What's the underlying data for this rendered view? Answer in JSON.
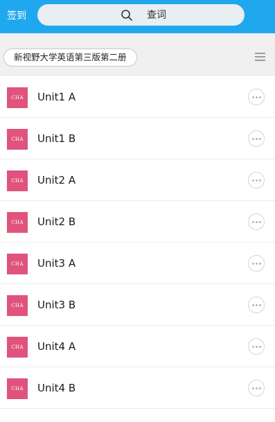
{
  "header": {
    "checkin_label": "签到",
    "search_label": "查词",
    "background_color": "#1fa8ee"
  },
  "book": {
    "title": "新视野大学英语第三版第二册"
  },
  "icons": {
    "search": "search-icon",
    "menu": "menu-icon",
    "more": "more-options-icon"
  },
  "units": [
    {
      "thumb": "CHA",
      "title": "Unit1 A"
    },
    {
      "thumb": "CHA",
      "title": "Unit1 B"
    },
    {
      "thumb": "CHA",
      "title": "Unit2 A"
    },
    {
      "thumb": "CHA",
      "title": "Unit2 B"
    },
    {
      "thumb": "CHA",
      "title": "Unit3 A"
    },
    {
      "thumb": "CHA",
      "title": "Unit3 B"
    },
    {
      "thumb": "CHA",
      "title": "Unit4 A"
    },
    {
      "thumb": "CHA",
      "title": "Unit4 B"
    }
  ],
  "colors": {
    "thumb_background": "#e0537d"
  }
}
